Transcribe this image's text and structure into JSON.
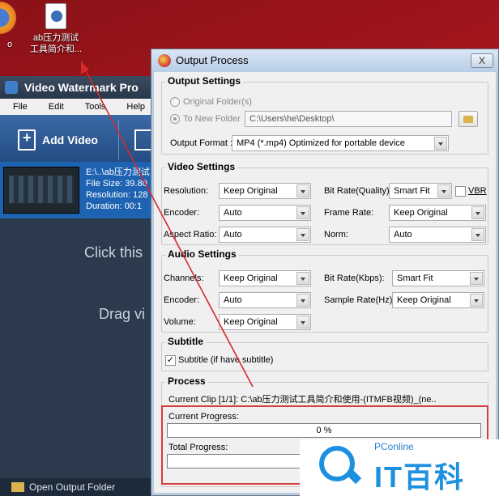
{
  "desktop": {
    "partial_icon_label": "o",
    "file_icon_label_line1": "ab压力测试",
    "file_icon_label_line2": "工具简介和..."
  },
  "background_app": {
    "title": "Video Watermark Pro",
    "menu": [
      "File",
      "Edit",
      "Tools",
      "Help"
    ],
    "add_video_label": "Add Video",
    "clip": {
      "path": "E:\\..\\ab压力测试",
      "file_size": "File Size: 39.80",
      "resolution": "Resolution: 128",
      "duration": "Duration: 00:1"
    },
    "hint_click": "Click this",
    "hint_drag": "Drag vi",
    "open_output_folder": "Open Output Folder"
  },
  "dialog": {
    "title": "Output Process",
    "close_label": "X",
    "output_settings": {
      "title": "Output Settings",
      "original_folder": "Original Folder(s)",
      "to_new_folder": "To New Folder",
      "folder_path": "C:\\Users\\he\\Desktop\\",
      "output_format_label": "Output Format :",
      "output_format_value": "MP4  (*.mp4) Optimized for portable device"
    },
    "video_settings": {
      "title": "Video Settings",
      "resolution_label": "Resolution:",
      "resolution_value": "Keep Original",
      "bitrate_label": "Bit Rate(Quality):",
      "bitrate_value": "Smart Fit",
      "vbr_label": "VBR",
      "encoder_label": "Encoder:",
      "encoder_value": "Auto",
      "framerate_label": "Frame Rate:",
      "framerate_value": "Keep Original",
      "aspect_label": "Aspect Ratio:",
      "aspect_value": "Auto",
      "norm_label": "Norm:",
      "norm_value": "Auto"
    },
    "audio_settings": {
      "title": "Audio Settings",
      "channels_label": "Channels:",
      "channels_value": "Keep Original",
      "bitrate_label": "Bit Rate(Kbps):",
      "bitrate_value": "Smart Fit",
      "encoder_label": "Encoder:",
      "encoder_value": "Auto",
      "samplerate_label": "Sample Rate(Hz):",
      "samplerate_value": "Keep Original",
      "volume_label": "Volume:",
      "volume_value": "Keep Original"
    },
    "subtitle": {
      "title": "Subtitle",
      "checkbox_label": "Subtitle (if have subtitle)",
      "checked": true
    },
    "process": {
      "title": "Process",
      "current_clip": "Current Clip [1/1]: C:\\ab压力测试工具简介和使用-(ITMFB视频)_(ne..",
      "current_progress_label": "Current Progress:",
      "current_progress_text": "0 %",
      "current_progress_value": 0,
      "total_progress_label": "Total Progress:"
    }
  },
  "watermark": {
    "brand": "PConline",
    "big_text": "IT百科"
  },
  "colors": {
    "annotation_red": "#d42a2a",
    "desktop_red": "#a8161c",
    "accent_blue": "#1e63b2"
  }
}
